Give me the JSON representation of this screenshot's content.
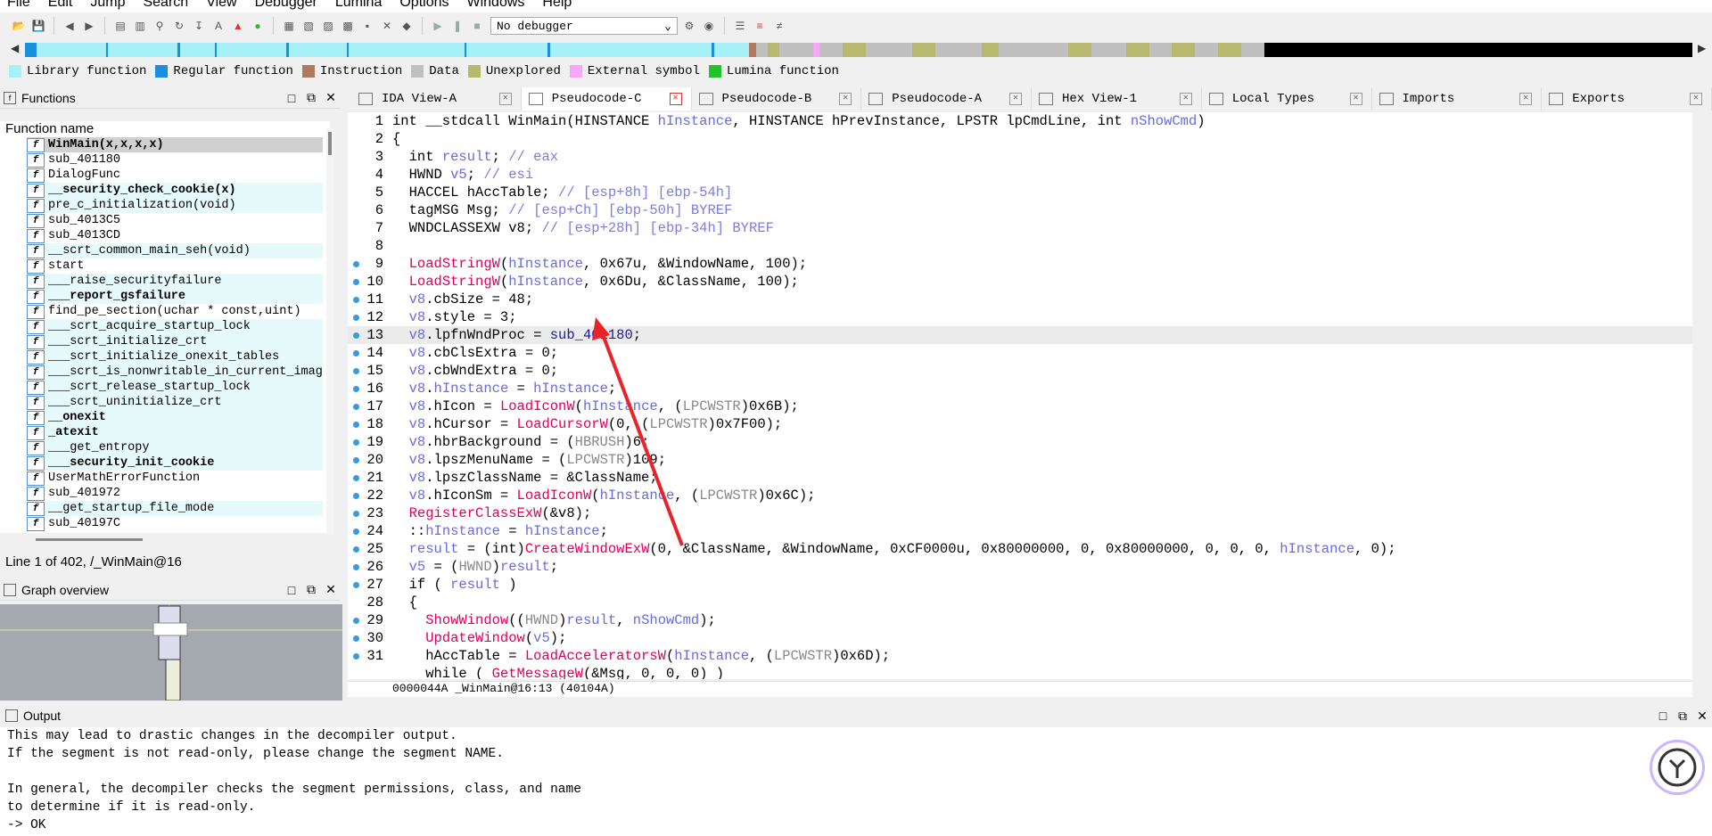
{
  "menu": [
    "File",
    "Edit",
    "Jump",
    "Search",
    "View",
    "Debugger",
    "Lumina",
    "Options",
    "Windows",
    "Help"
  ],
  "toolbar": {
    "debugger_value": "No debugger"
  },
  "legend": [
    {
      "label": "Library function",
      "color": "#a8f0f8"
    },
    {
      "label": "Regular function",
      "color": "#1a8fe0"
    },
    {
      "label": "Instruction",
      "color": "#b07860"
    },
    {
      "label": "Data",
      "color": "#c0c0c0"
    },
    {
      "label": "Unexplored",
      "color": "#b8b870"
    },
    {
      "label": "External symbol",
      "color": "#f5a8f5"
    },
    {
      "label": "Lumina function",
      "color": "#22c22a"
    }
  ],
  "functions_panel": {
    "title": "Functions",
    "column": "Function name",
    "items": [
      {
        "name": "WinMain(x,x,x,x)",
        "kind": "sel"
      },
      {
        "name": "sub_401180",
        "kind": "reg"
      },
      {
        "name": "DialogFunc",
        "kind": "reg"
      },
      {
        "name": "__security_check_cookie(x)",
        "kind": "libbold"
      },
      {
        "name": "pre_c_initialization(void)",
        "kind": "lib"
      },
      {
        "name": "sub_4013C5",
        "kind": "reg"
      },
      {
        "name": "sub_4013CD",
        "kind": "reg"
      },
      {
        "name": "__scrt_common_main_seh(void)",
        "kind": "lib"
      },
      {
        "name": "start",
        "kind": "reg"
      },
      {
        "name": "___raise_securityfailure",
        "kind": "lib"
      },
      {
        "name": "___report_gsfailure",
        "kind": "libbold"
      },
      {
        "name": "find_pe_section(uchar * const,uint)",
        "kind": "reg"
      },
      {
        "name": "___scrt_acquire_startup_lock",
        "kind": "lib"
      },
      {
        "name": "___scrt_initialize_crt",
        "kind": "lib"
      },
      {
        "name": "___scrt_initialize_onexit_tables",
        "kind": "lib"
      },
      {
        "name": "___scrt_is_nonwritable_in_current_image",
        "kind": "lib"
      },
      {
        "name": "___scrt_release_startup_lock",
        "kind": "lib"
      },
      {
        "name": "___scrt_uninitialize_crt",
        "kind": "lib"
      },
      {
        "name": "__onexit",
        "kind": "libbold"
      },
      {
        "name": "_atexit",
        "kind": "libbold"
      },
      {
        "name": "___get_entropy",
        "kind": "lib"
      },
      {
        "name": "___security_init_cookie",
        "kind": "libbold"
      },
      {
        "name": "UserMathErrorFunction",
        "kind": "reg"
      },
      {
        "name": "sub_401972",
        "kind": "reg"
      },
      {
        "name": "__get_startup_file_mode",
        "kind": "lib"
      },
      {
        "name": "sub_40197C",
        "kind": "reg"
      }
    ]
  },
  "line_info": "Line 1 of 402, /_WinMain@16",
  "graph_panel": {
    "title": "Graph overview"
  },
  "tabs": [
    {
      "label": "IDA View-A",
      "active": false
    },
    {
      "label": "Pseudocode-C",
      "active": true
    },
    {
      "label": "Pseudocode-B",
      "active": false
    },
    {
      "label": "Pseudocode-A",
      "active": false
    },
    {
      "label": "Hex View-1",
      "active": false
    },
    {
      "label": "Local Types",
      "active": false
    },
    {
      "label": "Imports",
      "active": false
    },
    {
      "label": "Exports",
      "active": false
    }
  ],
  "code_lines": [
    {
      "n": "1",
      "dot": false,
      "t": "int __stdcall WinMain(HINSTANCE hInstance, HINSTANCE hPrevInstance, LPSTR lpCmdLine, int nShowCmd)"
    },
    {
      "n": "2",
      "dot": false,
      "t": "{"
    },
    {
      "n": "3",
      "dot": false,
      "t": "  int result; // eax"
    },
    {
      "n": "4",
      "dot": false,
      "t": "  HWND v5; // esi"
    },
    {
      "n": "5",
      "dot": false,
      "t": "  HACCEL hAccTable; // [esp+8h] [ebp-54h]"
    },
    {
      "n": "6",
      "dot": false,
      "t": "  tagMSG Msg; // [esp+Ch] [ebp-50h] BYREF"
    },
    {
      "n": "7",
      "dot": false,
      "t": "  WNDCLASSEXW v8; // [esp+28h] [ebp-34h] BYREF"
    },
    {
      "n": "8",
      "dot": false,
      "t": ""
    },
    {
      "n": "9",
      "dot": true,
      "t": "  LoadStringW(hInstance, 0x67u, &WindowName, 100);"
    },
    {
      "n": "10",
      "dot": true,
      "t": "  LoadStringW(hInstance, 0x6Du, &ClassName, 100);"
    },
    {
      "n": "11",
      "dot": true,
      "t": "  v8.cbSize = 48;"
    },
    {
      "n": "12",
      "dot": true,
      "t": "  v8.style = 3;"
    },
    {
      "n": "13",
      "dot": true,
      "t": "  v8.lpfnWndProc = sub_401180;"
    },
    {
      "n": "14",
      "dot": true,
      "t": "  v8.cbClsExtra = 0;"
    },
    {
      "n": "15",
      "dot": true,
      "t": "  v8.cbWndExtra = 0;"
    },
    {
      "n": "16",
      "dot": true,
      "t": "  v8.hInstance = hInstance;"
    },
    {
      "n": "17",
      "dot": true,
      "t": "  v8.hIcon = LoadIconW(hInstance, (LPCWSTR)0x6B);"
    },
    {
      "n": "18",
      "dot": true,
      "t": "  v8.hCursor = LoadCursorW(0, (LPCWSTR)0x7F00);"
    },
    {
      "n": "19",
      "dot": true,
      "t": "  v8.hbrBackground = (HBRUSH)6;"
    },
    {
      "n": "20",
      "dot": true,
      "t": "  v8.lpszMenuName = (LPCWSTR)109;"
    },
    {
      "n": "21",
      "dot": true,
      "t": "  v8.lpszClassName = &ClassName;"
    },
    {
      "n": "22",
      "dot": true,
      "t": "  v8.hIconSm = LoadIconW(hInstance, (LPCWSTR)0x6C);"
    },
    {
      "n": "23",
      "dot": true,
      "t": "  RegisterClassExW(&v8);"
    },
    {
      "n": "24",
      "dot": true,
      "t": "  ::hInstance = hInstance;"
    },
    {
      "n": "25",
      "dot": true,
      "t": "  result = (int)CreateWindowExW(0, &ClassName, &WindowName, 0xCF0000u, 0x80000000, 0, 0x80000000, 0, 0, 0, hInstance, 0);"
    },
    {
      "n": "26",
      "dot": true,
      "t": "  v5 = (HWND)result;"
    },
    {
      "n": "27",
      "dot": true,
      "t": "  if ( result )"
    },
    {
      "n": "28",
      "dot": false,
      "t": "  {"
    },
    {
      "n": "29",
      "dot": true,
      "t": "    ShowWindow((HWND)result, nShowCmd);"
    },
    {
      "n": "30",
      "dot": true,
      "t": "    UpdateWindow(v5);"
    },
    {
      "n": "31",
      "dot": true,
      "t": "    hAccTable = LoadAcceleratorsW(hInstance, (LPCWSTR)0x6D);"
    },
    {
      "n": "",
      "dot": false,
      "t": "    while ( GetMessageW(&Msg, 0, 0, 0) )"
    }
  ],
  "code_status": "0000044A _WinMain@16:13 (40104A)",
  "output_panel": {
    "title": "Output",
    "lines": [
      "This may lead to drastic changes in the decompiler output.",
      "If the segment is not read-only, please change the segment NAME.",
      "",
      "In general, the decompiler checks the segment permissions, class, and name",
      "to determine if it is read-only.",
      " -> OK"
    ]
  }
}
